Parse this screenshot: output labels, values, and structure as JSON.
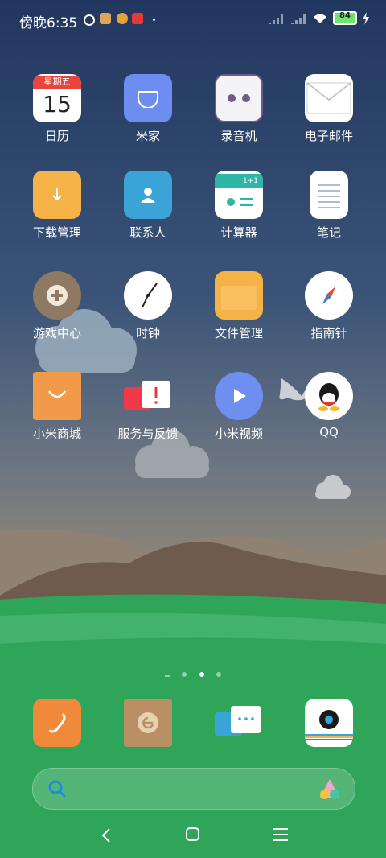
{
  "status": {
    "time": "傍晚6:35",
    "battery": "84"
  },
  "apps": [
    {
      "label": "日历",
      "calendar_weekday": "星期五",
      "calendar_day": "15"
    },
    {
      "label": "米家"
    },
    {
      "label": "录音机"
    },
    {
      "label": "电子邮件"
    },
    {
      "label": "下载管理"
    },
    {
      "label": "联系人"
    },
    {
      "label": "计算器",
      "calc_text": "1+1"
    },
    {
      "label": "笔记"
    },
    {
      "label": "游戏中心"
    },
    {
      "label": "时钟"
    },
    {
      "label": "文件管理"
    },
    {
      "label": "指南针"
    },
    {
      "label": "小米商城"
    },
    {
      "label": "服务与反馈"
    },
    {
      "label": "小米视频"
    },
    {
      "label": "QQ"
    }
  ],
  "icons": [
    "calendar-icon",
    "mijia-icon",
    "recorder-icon",
    "email-icon",
    "download-icon",
    "contacts-icon",
    "calculator-icon",
    "notes-icon",
    "game-center-icon",
    "clock-icon",
    "file-manager-icon",
    "compass-icon",
    "mi-store-icon",
    "service-feedback-icon",
    "mi-video-icon",
    "qq-icon"
  ],
  "dock": [
    "phone-icon",
    "browser-icon",
    "messages-icon",
    "camera-icon"
  ],
  "page_indicator": {
    "pages": 4,
    "active": 2
  },
  "colors": {
    "sky_top": "#2a3f6a",
    "grass": "#2fa55a",
    "accent": "#ffffff"
  }
}
